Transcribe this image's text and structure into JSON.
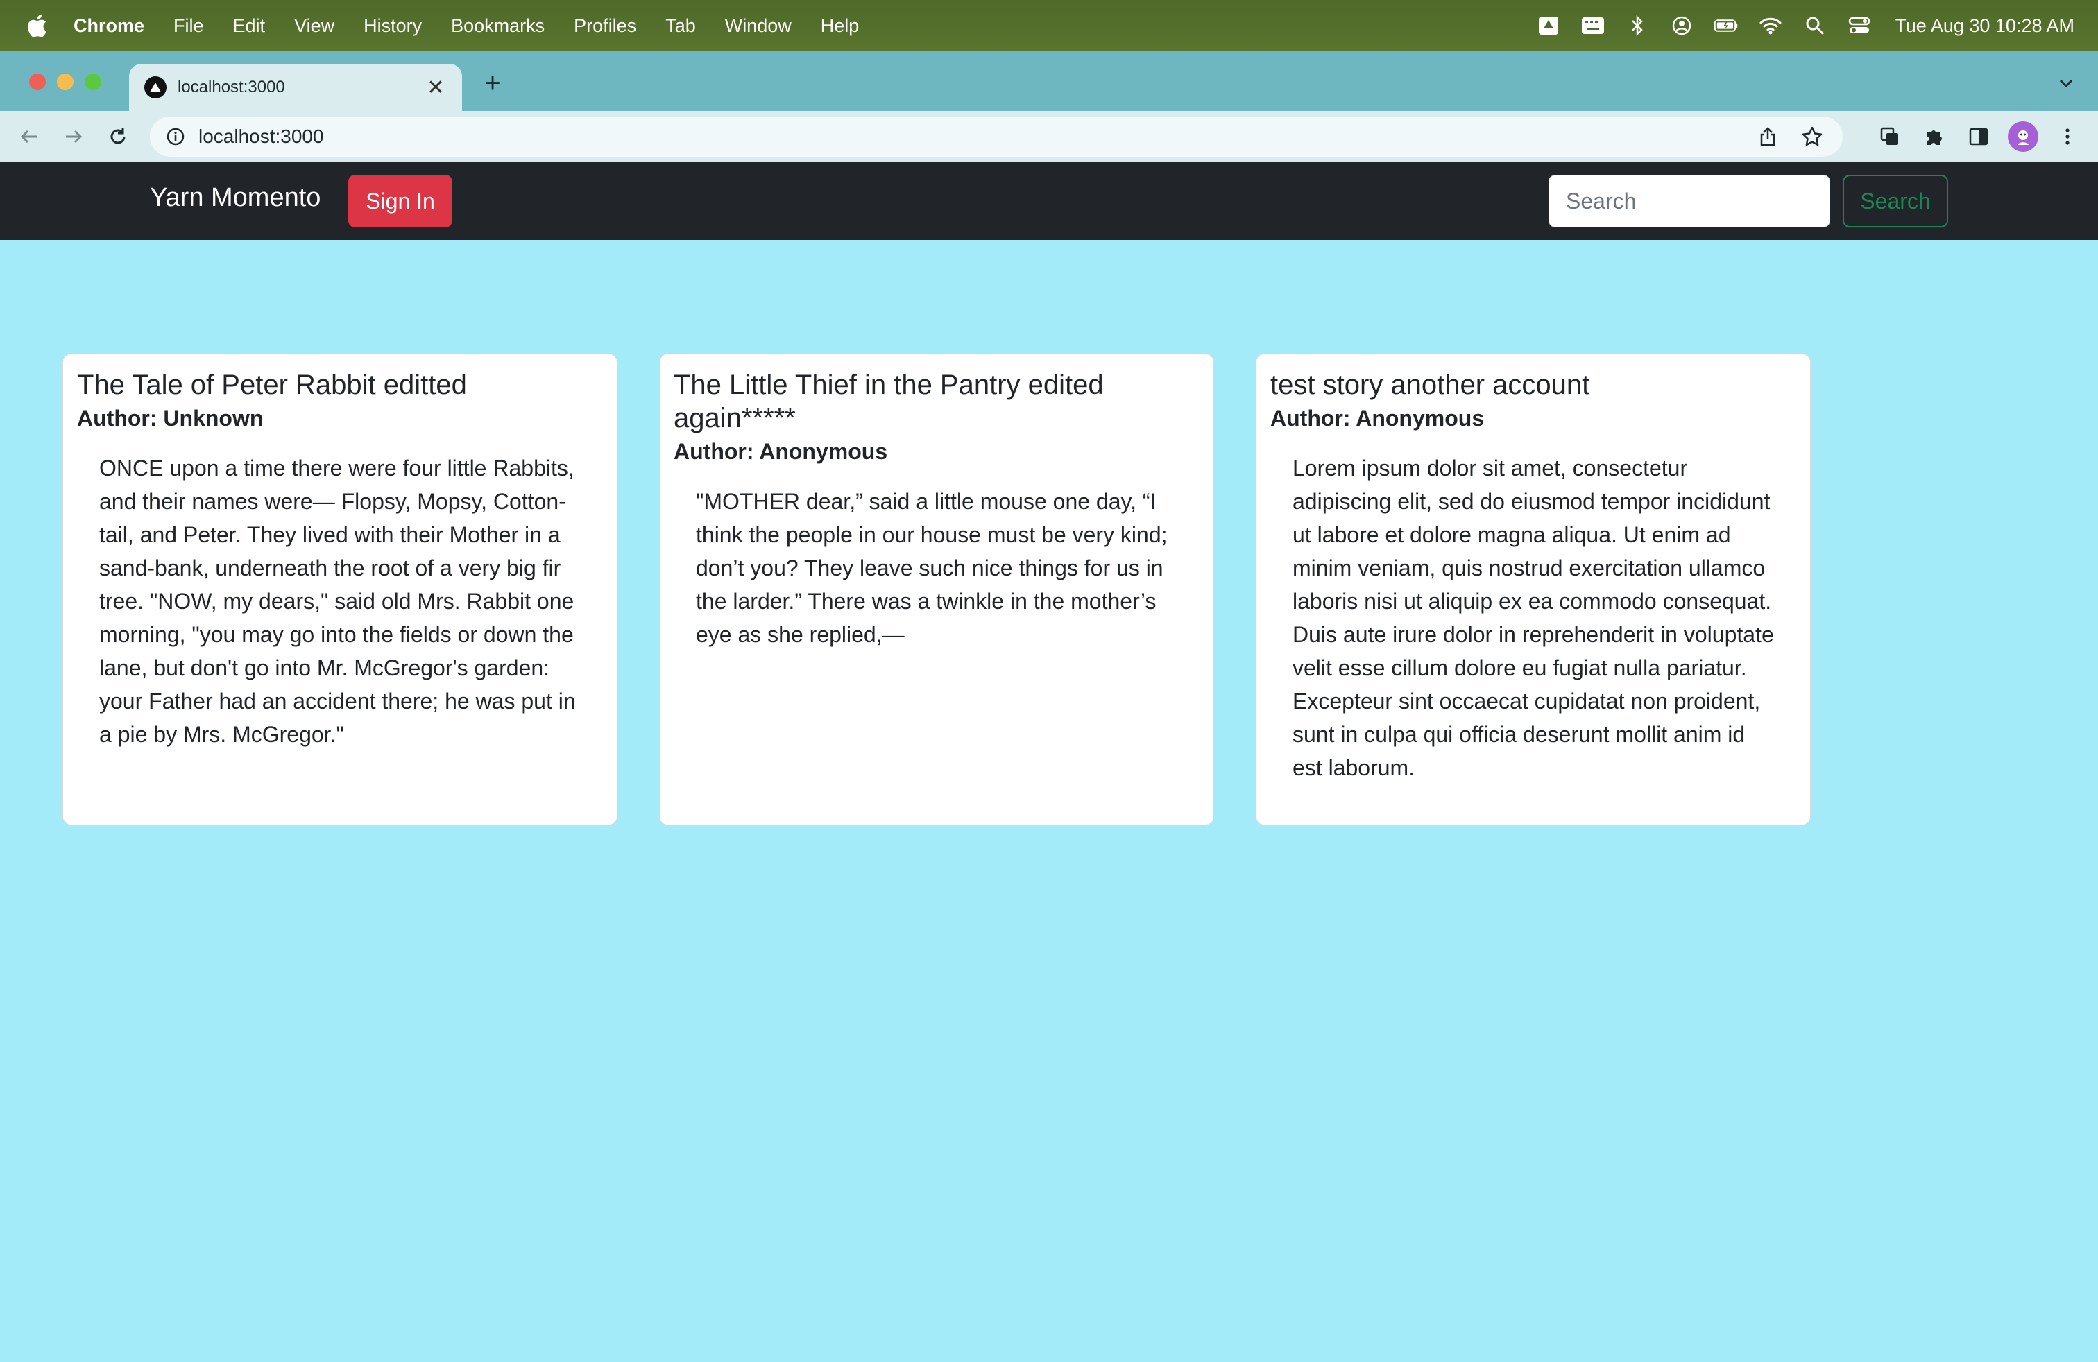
{
  "menubar": {
    "app_name": "Chrome",
    "items": [
      "File",
      "Edit",
      "View",
      "History",
      "Bookmarks",
      "Profiles",
      "Tab",
      "Window",
      "Help"
    ],
    "clock": "Tue Aug 30  10:28 AM"
  },
  "browser": {
    "tab_title": "localhost:3000",
    "url": "localhost:3000"
  },
  "navbar": {
    "brand": "Yarn Momento",
    "signin_label": "Sign In",
    "search_placeholder": "Search",
    "search_button": "Search"
  },
  "colors": {
    "page_background": "#a3ebf8",
    "navbar_background": "#212529",
    "signin_button": "#dc3545",
    "search_button": "#198754"
  },
  "stories": [
    {
      "title": "The Tale of Peter Rabbit editted",
      "author": "Author: Unknown",
      "body": "ONCE upon a time there were four little Rabbits, and their names were— Flopsy, Mopsy, Cotton-tail, and Peter. They lived with their Mother in a sand-bank, underneath the root of a very big fir tree. \"NOW, my dears,\" said old Mrs. Rabbit one morning, \"you may go into the fields or down the lane, but don't go into Mr. McGregor's garden: your Father had an accident there; he was put in a pie by Mrs. McGregor.\""
    },
    {
      "title": "The Little Thief in the Pantry edited again*****",
      "author": "Author: Anonymous",
      "body": "\"MOTHER dear,” said a little mouse one day, “I think the people in our house must be very kind; don’t you? They leave such nice things for us in the larder.” There was a twinkle in the mother’s eye as she replied,—"
    },
    {
      "title": "test story another account",
      "author": "Author: Anonymous",
      "body": "Lorem ipsum dolor sit amet, consectetur adipiscing elit, sed do eiusmod tempor incididunt ut labore et dolore magna aliqua. Ut enim ad minim veniam, quis nostrud exercitation ullamco laboris nisi ut aliquip ex ea commodo consequat. Duis aute irure dolor in reprehenderit in voluptate velit esse cillum dolore eu fugiat nulla pariatur. Excepteur sint occaecat cupidatat non proident, sunt in culpa qui officia deserunt mollit anim id est laborum."
    }
  ]
}
